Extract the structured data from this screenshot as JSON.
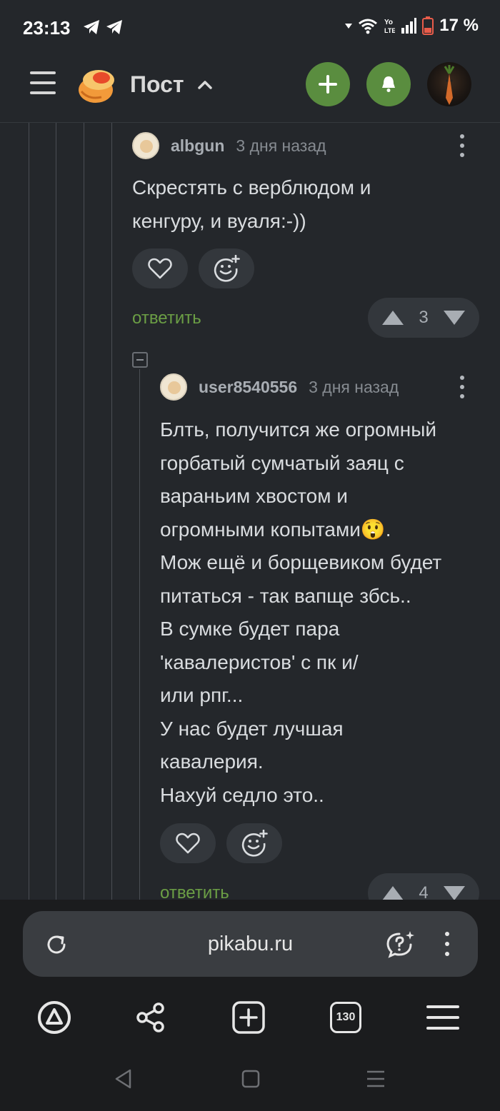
{
  "status_bar": {
    "time": "23:13",
    "battery_percent": "17 %",
    "icons": [
      "telegram-icon",
      "telegram-icon",
      "wifi-icon",
      "volte-icon",
      "signal-icon",
      "battery-low-icon"
    ]
  },
  "header": {
    "title": "Пост",
    "icons": [
      "menu-icon",
      "pikabu-logo",
      "chevron-up-icon",
      "plus-icon",
      "bell-icon",
      "user-avatar"
    ],
    "accent_color": "#5a8d3f"
  },
  "comments": [
    {
      "username": "albgun",
      "time": "3 дня назад",
      "lines": [
        "Скрестять с верблюдом и",
        "кенгуру, и вуаля:-))"
      ],
      "reply_label": "ответить",
      "rating": "3"
    },
    {
      "username": "user8540556",
      "time": "3 дня назад",
      "lines": [
        "Блть, получится же огромный",
        "горбатый сумчатый заяц с",
        "вараньим хвостом и",
        "огромными копытами😲.",
        "Мож ещё и борщевиком будет",
        "питаться - так вапще збсь..",
        "В сумке будет пара",
        "'кавалеристов' с пк и/",
        "или рпг...",
        "У нас будет лучшая",
        "кавалерия.",
        "Нахуй седло это.."
      ],
      "reply_label": "ответить",
      "rating": "4"
    }
  ],
  "browser": {
    "url": "pikabu.ru",
    "tabs_count": "130",
    "icons": [
      "reload-icon",
      "assistant-chat-icon",
      "more-vert-icon",
      "alice-icon",
      "share-icon",
      "new-tab-icon",
      "tabs-icon",
      "menu-icon"
    ]
  },
  "colors": {
    "background": "#24272b",
    "reply_green": "#6b9e45",
    "pill": "#33373c"
  }
}
